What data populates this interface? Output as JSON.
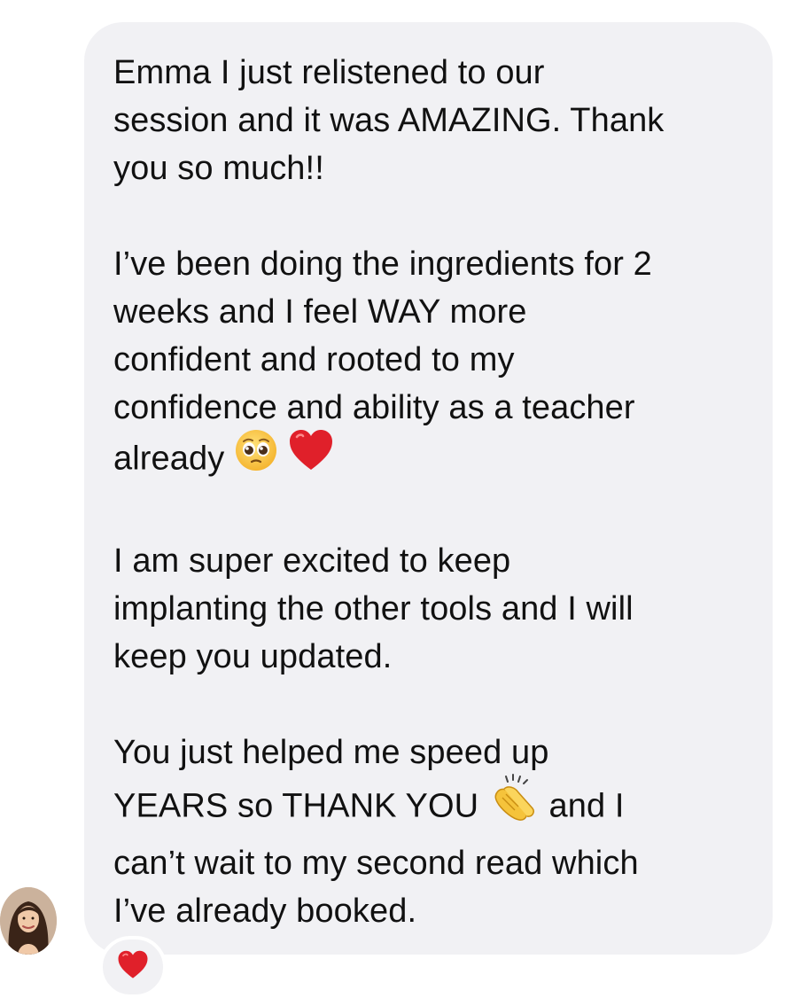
{
  "message": {
    "paragraph1": {
      "line1": "Emma I just relistened to our",
      "line2": "session and it was AMAZING. Thank",
      "line3": "you so much!!"
    },
    "paragraph2": {
      "line1": "I’ve been doing the ingredients for 2",
      "line2": "weeks and I feel WAY more",
      "line3": "confident and rooted to my",
      "line4": "confidence and ability as a teacher",
      "line5": "already"
    },
    "paragraph3": {
      "line1": "I am super excited to keep",
      "line2": "implanting the other tools and I will",
      "line3": "keep you updated."
    },
    "paragraph4": {
      "line1": "You just helped me speed up",
      "line2_before": "YEARS so THANK YOU",
      "line2_after": "and I",
      "line3": "can’t wait to my second read which",
      "line4": "I’ve already booked."
    }
  },
  "icons": {
    "pleading_face": "pleading-face-icon",
    "red_heart": "red-heart-icon",
    "clapping_hands": "clapping-hands-icon",
    "reaction_heart": "red-heart-icon",
    "sender_avatar": "avatar"
  },
  "colors": {
    "bubble": "#f1f1f4",
    "text": "#111111",
    "heart": "#e0202a",
    "clap": "#f5c33b"
  }
}
